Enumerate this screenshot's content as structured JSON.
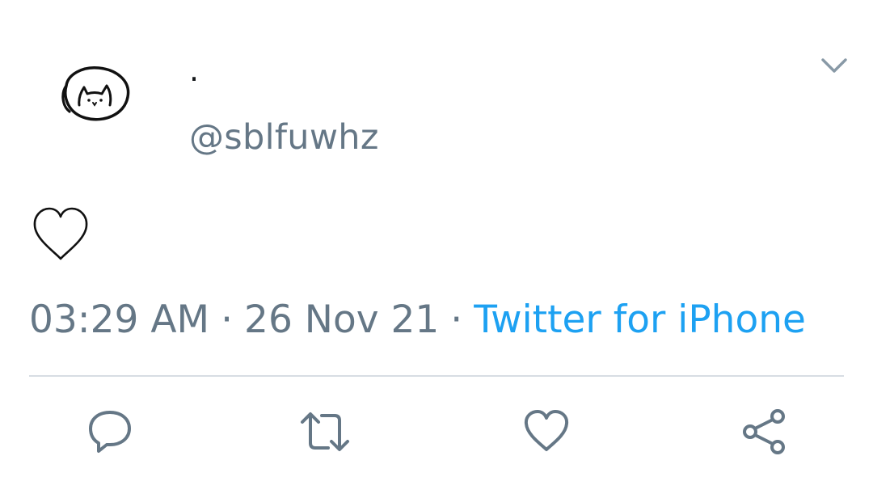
{
  "author": {
    "display_name": "·",
    "handle": "@sblfuwhz",
    "avatar_icon": "cat-doodle-avatar"
  },
  "tweet": {
    "content_icon": "heart-outline-emoji"
  },
  "meta": {
    "time": "03:29 AM",
    "separator": "·",
    "date": "26 Nov 21",
    "source": "Twitter for iPhone"
  },
  "actions": [
    {
      "name": "reply",
      "icon": "speech-bubble-icon"
    },
    {
      "name": "retweet",
      "icon": "retweet-arrows-icon"
    },
    {
      "name": "like",
      "icon": "heart-icon"
    },
    {
      "name": "share",
      "icon": "share-nodes-icon"
    }
  ],
  "colors": {
    "text_primary": "#14171a",
    "text_secondary": "#657786",
    "link": "#1da1f2",
    "divider": "#d7dde3",
    "icon": "#657786"
  }
}
